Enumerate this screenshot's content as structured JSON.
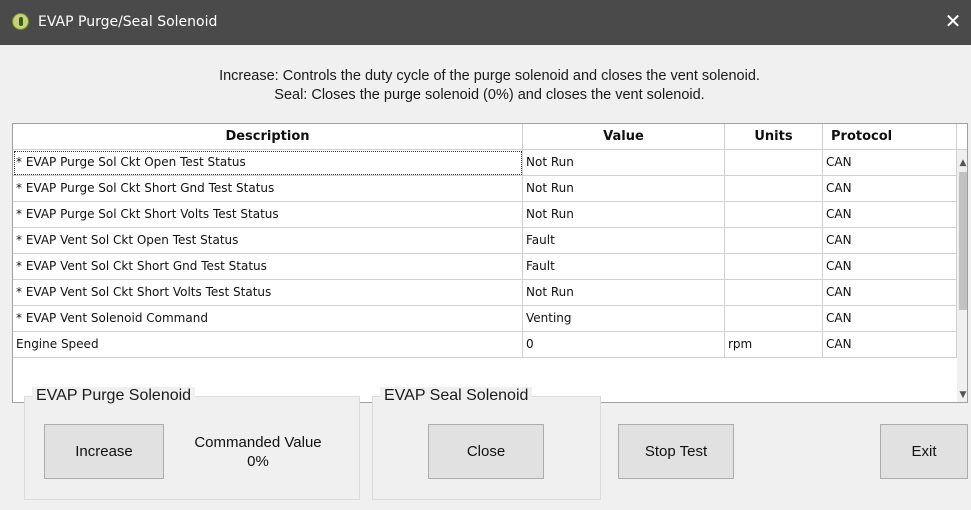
{
  "window": {
    "title": "EVAP Purge/Seal Solenoid",
    "close_glyph": "✕"
  },
  "instructions": {
    "line1": "Increase: Controls the duty cycle of the purge solenoid and closes the vent solenoid.",
    "line2": "Seal: Closes the purge solenoid (0%) and closes the vent solenoid."
  },
  "table": {
    "columns": [
      "Description",
      "Value",
      "Units",
      "Protocol"
    ],
    "rows": [
      {
        "description": "* EVAP Purge Sol Ckt Open Test Status",
        "value": "Not Run",
        "units": "",
        "protocol": "CAN"
      },
      {
        "description": "* EVAP Purge Sol Ckt Short Gnd Test Status",
        "value": "Not Run",
        "units": "",
        "protocol": "CAN"
      },
      {
        "description": "* EVAP Purge Sol Ckt Short Volts Test Status",
        "value": "Not Run",
        "units": "",
        "protocol": "CAN"
      },
      {
        "description": "* EVAP Vent Sol Ckt Open Test Status",
        "value": "Fault",
        "units": "",
        "protocol": "CAN"
      },
      {
        "description": "* EVAP Vent Sol Ckt Short Gnd Test Status",
        "value": "Fault",
        "units": "",
        "protocol": "CAN"
      },
      {
        "description": "* EVAP Vent Sol Ckt Short Volts Test Status",
        "value": "Not Run",
        "units": "",
        "protocol": "CAN"
      },
      {
        "description": "* EVAP Vent Solenoid Command",
        "value": "Venting",
        "units": "",
        "protocol": "CAN"
      },
      {
        "description": "Engine Speed",
        "value": "0",
        "units": "rpm",
        "protocol": "CAN"
      }
    ]
  },
  "purge_group": {
    "title": "EVAP Purge Solenoid",
    "increase_label": "Increase",
    "commanded_label": "Commanded Value",
    "commanded_value": "0%"
  },
  "seal_group": {
    "title": "EVAP Seal Solenoid",
    "close_label": "Close"
  },
  "buttons": {
    "stop_test": "Stop Test",
    "exit": "Exit"
  },
  "colors": {
    "titlebar": "#4a4a4a",
    "window_bg": "#f0f0f0",
    "button_bg": "#e1e1e1"
  }
}
